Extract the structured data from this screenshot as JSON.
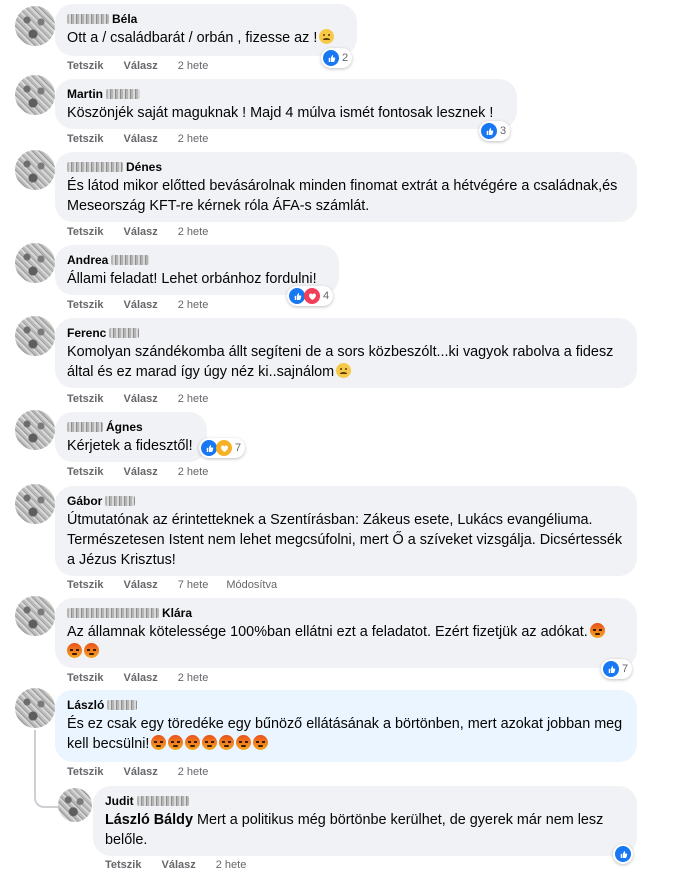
{
  "actions": {
    "like": "Tetszik",
    "reply": "Válasz",
    "edited": "Módosítva"
  },
  "comments": [
    {
      "name": "Béla",
      "text": "Ott a / családbarát / orbán , fizesse az !",
      "time": "2 hete",
      "reaction_count": "2",
      "reactions": [
        "like"
      ]
    },
    {
      "name": "Martin",
      "text": "Köszönjék saját maguknak ! Majd 4 múlva ismét fontosak lesznek !",
      "time": "2 hete",
      "reaction_count": "3",
      "reactions": [
        "like"
      ]
    },
    {
      "name": "Dénes",
      "text": "És látod mikor előtted bevásárolnak minden finomat extrát a hétvégére a családnak,és Meseország KFT-re kérnek róla ÁFA-s számlát.",
      "time": "2 hete"
    },
    {
      "name": "Andrea",
      "text": "Állami feladat! Lehet orbánhoz fordulni!",
      "time": "2 hete",
      "reaction_count": "4",
      "reactions": [
        "like",
        "love"
      ]
    },
    {
      "name": "Ferenc",
      "text": "Komolyan szándékomba állt segíteni de a sors közbeszólt...ki vagyok rabolva a fidesz által és ez marad így úgy néz ki..sajnálom",
      "time": "2 hete"
    },
    {
      "name": "Ágnes",
      "text": "Kérjetek a fidesztől!",
      "time": "2 hete",
      "reaction_count": "7",
      "reactions": [
        "like",
        "care"
      ]
    },
    {
      "name": "Gábor",
      "text": "Útmutatónak az érintetteknek a Szentírásban: Zákeus esete, Lukács evangéliuma. Természetesen Istent nem lehet megcsúfolni, mert Ő a szíveket vizsgálja. Dicsértessék a Jézus Krisztus!",
      "time": "7 hete"
    },
    {
      "name": "Klára",
      "text": "Az államnak kötelessége 100%ban ellátni ezt a feladatot. Ezért fizetjük az adókat.",
      "time": "2 hete",
      "reaction_count": "7",
      "reactions": [
        "like"
      ]
    },
    {
      "name": "László",
      "text": "És ez csak egy töredéke egy bűnöző ellátásának a börtönben, mert azokat jobban meg kell becsülni!",
      "time": "2 hete"
    }
  ],
  "reply": {
    "name": "Judit",
    "mention": "László Báldy",
    "text": " Mert a politikus még börtönbe kerülhet, de gyerek már nem lesz belőle.",
    "time": "2 hete",
    "reactions": [
      "like"
    ]
  },
  "icons": {
    "like": "thumbs-up-icon",
    "love": "heart-icon",
    "care": "care-icon",
    "confused": "confused-face-icon",
    "angry": "angry-face-icon"
  },
  "colors": {
    "like": "#1877f2",
    "love": "#f33e58",
    "bubble": "#f0f2f5",
    "highlight": "#ebf5ff",
    "meta": "#65676b"
  }
}
